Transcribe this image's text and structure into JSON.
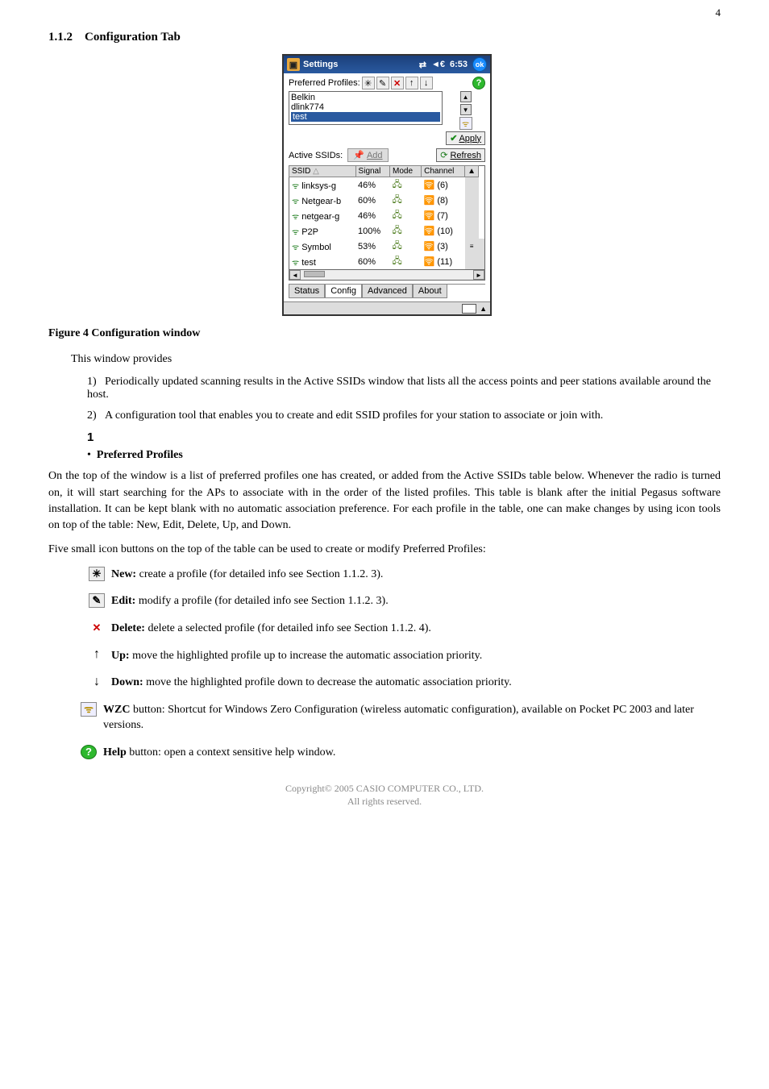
{
  "page_number": "4",
  "section_number": "1.1.2",
  "section_title": "Configuration Tab",
  "figure_caption": "Figure 4 Configuration window",
  "settings_window": {
    "title": "Settings",
    "time": "6:53",
    "conn_glyph": "⇄",
    "vol_glyph": "◄",
    "ok_label": "ok",
    "preferred_label": "Preferred Profiles:",
    "profiles": [
      "Belkin",
      "dlink774",
      "test"
    ],
    "apply_label": "Apply",
    "active_label": "Active SSIDs:",
    "add_label": "Add",
    "refresh_label": "Refresh",
    "columns": [
      "SSID",
      "Signal",
      "Mode",
      "Channel"
    ],
    "sort_col": "SSID",
    "rows": [
      {
        "ssid": "linksys-g",
        "signal": "46%",
        "channel": "(6)"
      },
      {
        "ssid": "Netgear-b",
        "signal": "60%",
        "channel": "(8)"
      },
      {
        "ssid": "netgear-g",
        "signal": "46%",
        "channel": "(7)"
      },
      {
        "ssid": "P2P",
        "signal": "100%",
        "channel": "(10)"
      },
      {
        "ssid": "Symbol",
        "signal": "53%",
        "channel": "(3)"
      },
      {
        "ssid": "test",
        "signal": "60%",
        "channel": "(11)"
      }
    ],
    "tabs": [
      "Status",
      "Config",
      "Advanced",
      "About"
    ],
    "active_tab": "Config"
  },
  "body": {
    "intro": "This window provides",
    "item1": "Periodically updated scanning results in the Active SSIDs window that lists all the access points and peer stations available around the host.",
    "item2": "A configuration tool that enables you to create and edit SSID profiles for your station to associate or join with.",
    "one_mark": "1",
    "preferred_head": "Preferred Profiles",
    "preferred_para": "On the top of the window is a list of preferred profiles one has created, or added from the Active SSIDs table below. Whenever the radio is turned on, it will start searching for the APs to associate with in the order of the listed profiles. This table is blank after the initial Pegasus software installation. It can be kept blank with no automatic association preference. For each profile in the table, one can make changes by using icon tools on top of the table: New, Edit, Delete, Up, and Down.",
    "five_icons_intro": "Five small icon buttons on the top of the table can be used to create or modify Preferred Profiles:",
    "defs": {
      "new_label": "New:",
      "new_text": " create a profile (for detailed info see Section 1.1.2. 3).",
      "edit_label": "Edit:",
      "edit_text": " modify a profile (for detailed info see Section 1.1.2. 3).",
      "delete_label": "Delete:",
      "delete_text": " delete a selected profile (for detailed info see Section 1.1.2. 4).",
      "up_label": "Up:",
      "up_text": " move the highlighted profile up to increase the automatic association priority.",
      "down_label": "Down:",
      "down_text": " move the highlighted profile down to decrease the automatic association priority.",
      "wzc_label": "WZC",
      "wzc_text": " button: Shortcut for Windows Zero Configuration (wireless automatic configuration), available on Pocket PC 2003 and later versions.",
      "help_label": "Help",
      "help_text": " button: open a context sensitive help window."
    }
  },
  "footer": {
    "line1": "Copyright© 2005 CASIO COMPUTER CO., LTD.",
    "line2": "All rights reserved."
  }
}
